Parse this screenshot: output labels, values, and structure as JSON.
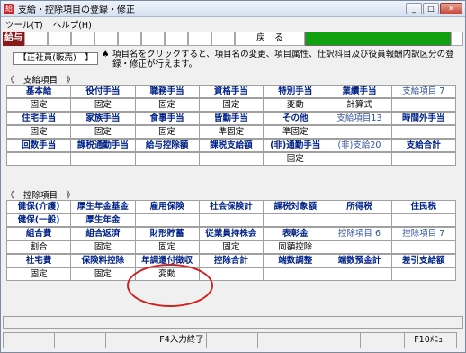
{
  "window": {
    "title": "支給・控除項目の登録・修正",
    "icon": "app-icon"
  },
  "menu": [
    "ツール(T)",
    "ヘルプ(H)"
  ],
  "header": {
    "badge": "給与",
    "back_label": "戻　る",
    "green_bar_color": "#10a010"
  },
  "employee_type": "【正社員(販売)　】",
  "info_text": "項目名をクリックすると、項目名の変更、項目属性、仕訳科目及び役員報酬内訳区分の登録・修正が行えます。",
  "info_icon": "spade-bullet-icon",
  "payment": {
    "title": "《　支給項目　》",
    "rows": [
      {
        "labels": [
          "基本給",
          "役付手当",
          "職務手当",
          "資格手当",
          "特別手当",
          "業績手当",
          "支給項目 7"
        ],
        "values": [
          "固定",
          "固定",
          "固定",
          "固定",
          "変動",
          "計算式",
          ""
        ]
      },
      {
        "labels": [
          "住宅手当",
          "家族手当",
          "食事手当",
          "皆勤手当",
          "その他",
          "支給項目13",
          "時間外手当"
        ],
        "values": [
          "固定",
          "固定",
          "固定",
          "準固定",
          "準固定",
          "",
          ""
        ]
      },
      {
        "labels": [
          "回数手当",
          "課税通勤手当",
          "給与控除額",
          "課税支給額",
          "(非)通勤手当",
          "(非)支給20",
          "支給合計"
        ],
        "values": [
          "",
          "",
          "",
          "",
          "固定",
          "",
          ""
        ]
      }
    ]
  },
  "deduction": {
    "title": "《　控除項目　》",
    "rows": [
      {
        "labels": [
          "健保(介護)",
          "厚生年金基金",
          "雇用保険",
          "社会保険計",
          "課税対象額",
          "所得税",
          "住民税"
        ],
        "values": [
          "健保(一般)",
          "厚生年金",
          "",
          "",
          "",
          "",
          ""
        ]
      },
      {
        "labels": [
          "組合費",
          "組合返済",
          "財形貯蓄",
          "従業員持株会",
          "表彰金",
          "控除項目 6",
          "控除項目 7"
        ],
        "values": [
          "割合",
          "固定",
          "固定",
          "固定",
          "同額控除",
          "",
          ""
        ]
      },
      {
        "labels": [
          "社宅費",
          "保険料控除",
          "年調還付徴収",
          "控除合計",
          "端数調整",
          "端数預金計",
          "差引支給額"
        ],
        "values": [
          "固定",
          "固定",
          "変動",
          "",
          "",
          "",
          ""
        ]
      }
    ]
  },
  "statusbar": {
    "f4": "F4入力終了",
    "f10": "F10ﾒﾆｭｰ"
  },
  "annotation_color": "#d0201f"
}
